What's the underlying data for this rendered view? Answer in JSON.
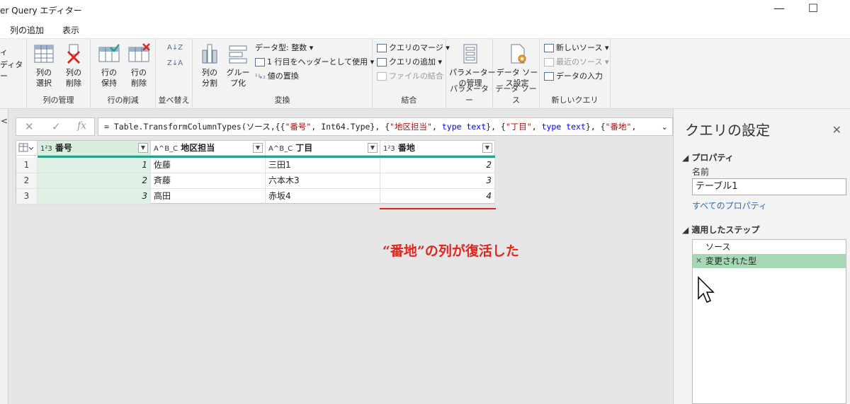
{
  "title_bar": {
    "title": "er Query エディター",
    "maximize_glyph": "☐",
    "minimize_glyph": "—"
  },
  "menu_tabs": [
    "列の追加",
    "表示"
  ],
  "ribbon": {
    "partial_left": [
      "ィ",
      "ディター"
    ],
    "groups": {
      "manage_columns": {
        "label": "列の管理",
        "choose": "列の\n選択",
        "remove": "列の\n削除"
      },
      "reduce_rows": {
        "label": "行の削減",
        "keep": "行の\n保持",
        "remove": "行の\n削除"
      },
      "sort": {
        "label": "並べ替え",
        "asc": "A↓Z",
        "desc": "Z↓A"
      },
      "transform": {
        "label": "変換",
        "split": "列の\n分割",
        "group_by": "グルー\nプ化",
        "data_type": "データ型: 整数",
        "first_row_header": "1 行目をヘッダーとして使用",
        "replace_values": "値の置換"
      },
      "combine": {
        "label": "結合",
        "merge": "クエリのマージ",
        "append": "クエリの追加",
        "combine_files": "ファイルの結合"
      },
      "parameters": {
        "label": "パラメーター",
        "manage": "パラメーター\nの管理"
      },
      "data_source": {
        "label": "データ ソース",
        "settings": "データ ソー\nス設定"
      },
      "new_query": {
        "label": "新しいクエリ",
        "new_source": "新しいソース",
        "recent": "最近のソース",
        "enter_data": "データの入力"
      }
    }
  },
  "left_nav": {
    "collapse_glyph": "<"
  },
  "formula_bar": {
    "cancel": "✕",
    "commit": "✓",
    "fx": "fx",
    "prefix": "= Table.TransformColumnTypes(ソース,{{",
    "s1": "\"番号\"",
    "p1": ", Int64.Type}, {",
    "s2": "\"地区担当\"",
    "p2": ", ",
    "kw1": "type text",
    "p3": "}, {",
    "s3": "\"丁目\"",
    "p4": ", ",
    "kw2": "type text",
    "p5": "}, {",
    "s4": "\"番地\"",
    "p6": ",",
    "expand": "⌄"
  },
  "table": {
    "columns": [
      {
        "type": "1²3",
        "name": "番号"
      },
      {
        "type": "A^B_C",
        "name": "地区担当"
      },
      {
        "type": "A^B_C",
        "name": "丁目"
      },
      {
        "type": "1²3",
        "name": "番地"
      }
    ],
    "rows": [
      {
        "n": "1",
        "c1": "1",
        "c2": "佐藤",
        "c3": "三田1",
        "c4": "2"
      },
      {
        "n": "2",
        "c1": "2",
        "c2": "斉藤",
        "c3": "六本木3",
        "c4": "3"
      },
      {
        "n": "3",
        "c1": "3",
        "c2": "高田",
        "c3": "赤坂4",
        "c4": "4"
      }
    ]
  },
  "annotation": "“番地”の列が復活した",
  "query_settings": {
    "title": "クエリの設定",
    "close": "✕",
    "properties_header": "◢ プロパティ",
    "name_label": "名前",
    "name_value": "テーブル1",
    "all_properties": "すべてのプロパティ",
    "applied_steps_header": "◢ 適用したステップ",
    "steps": [
      "ソース",
      "変更された型"
    ],
    "step_delete": "✕"
  },
  "colors": {
    "accent": "#26a28a",
    "selected_step": "#a7d8b5",
    "annotation": "#e0261f"
  }
}
